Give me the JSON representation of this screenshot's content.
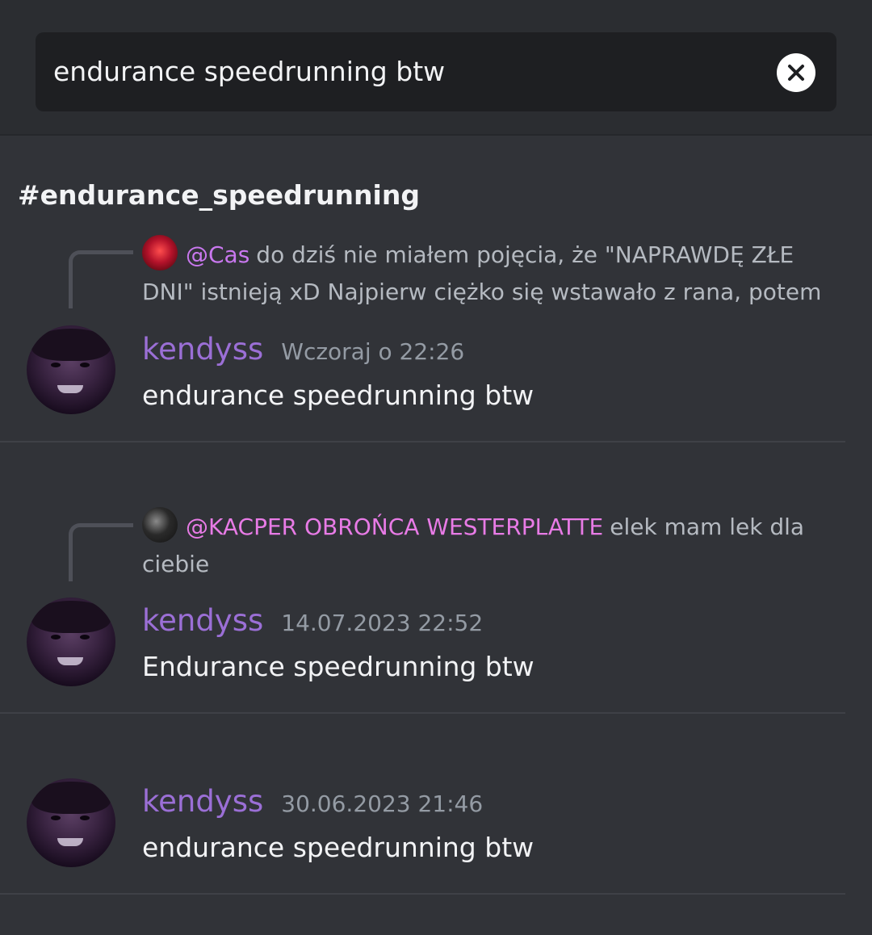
{
  "search": {
    "query": "endurance speedrunning btw"
  },
  "channel": {
    "name": "#endurance_speedrunning"
  },
  "results": [
    {
      "reply": {
        "mention": "@Cas",
        "text": "do dziś nie miałem pojęcia, że \"NAPRAWDĘ ZŁE DNI\" istnieją xD Najpierw ciężko się wstawało z rana, potem"
      },
      "author": "kendyss",
      "timestamp": "Wczoraj o 22:26",
      "content": "endurance speedrunning btw"
    },
    {
      "reply": {
        "mention": "@KACPER OBROŃCA WESTERPLATTE",
        "text": "elek mam lek dla ciebie"
      },
      "author": "kendyss",
      "timestamp": "14.07.2023 22:52",
      "content": "Endurance speedrunning btw"
    },
    {
      "author": "kendyss",
      "timestamp": "30.06.2023 21:46",
      "content": "endurance speedrunning btw"
    }
  ]
}
